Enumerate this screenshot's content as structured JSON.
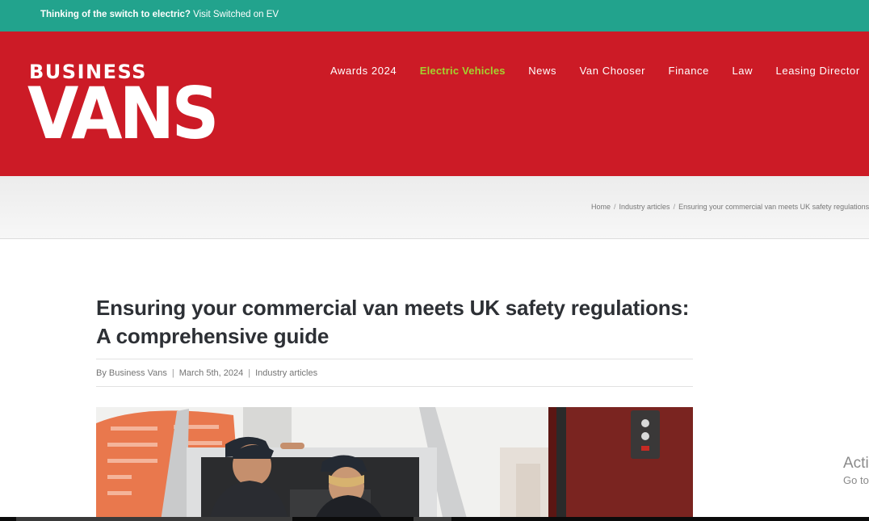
{
  "topbar": {
    "promo_bold": "Thinking of the switch to electric?",
    "promo_link": "Visit Switched on EV"
  },
  "logo": {
    "line1": "BUSINESS",
    "line2": "VANS"
  },
  "nav": {
    "items": [
      {
        "label": "Awards 2024",
        "active": false
      },
      {
        "label": "Electric Vehicles",
        "active": true
      },
      {
        "label": "News",
        "active": false
      },
      {
        "label": "Van Chooser",
        "active": false
      },
      {
        "label": "Finance",
        "active": false
      },
      {
        "label": "Law",
        "active": false
      },
      {
        "label": "Leasing Director",
        "active": false
      }
    ]
  },
  "breadcrumb": {
    "home": "Home",
    "sep": "/",
    "category": "Industry articles",
    "current": "Ensuring your commercial van meets UK safety regulations"
  },
  "article": {
    "title": "Ensuring your commercial van meets UK safety regulations: A comprehensive guide",
    "author": "By Business Vans",
    "sep": "|",
    "date": "March 5th, 2024",
    "category": "Industry articles"
  },
  "watermark": {
    "line1": "Acti",
    "line2": "Go to"
  },
  "colors": {
    "topbar": "#22a38d",
    "header": "#cc1b26",
    "nav_active": "#a3d12f"
  }
}
